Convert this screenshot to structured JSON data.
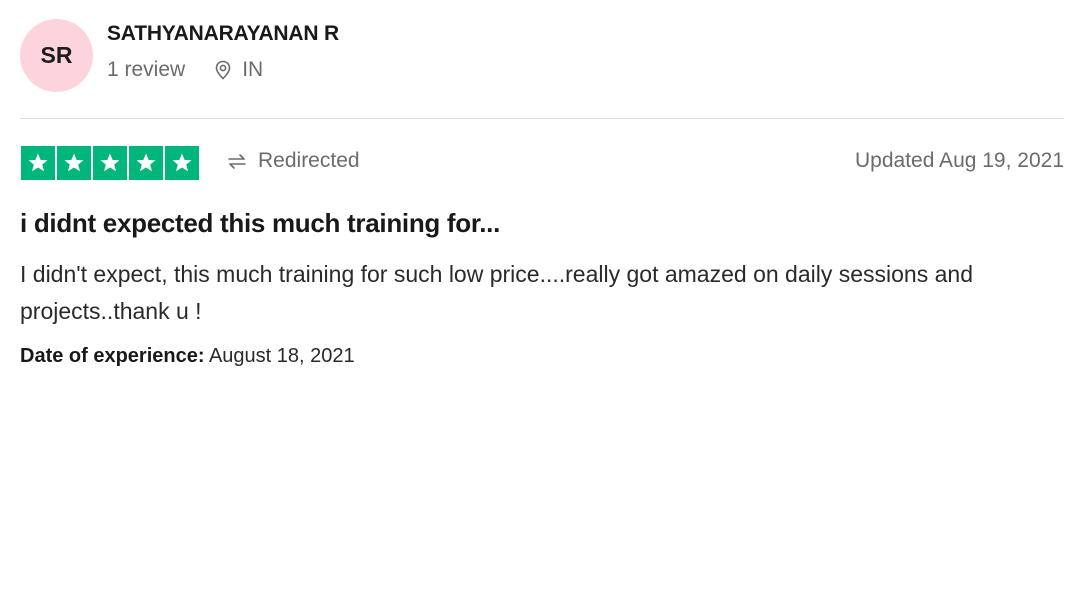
{
  "reviewer": {
    "initials": "SR",
    "avatar_color": "#fdd3dd",
    "name": "SATHYANARAYANAN R",
    "review_count": "1 review",
    "location_icon": "location-pin-icon",
    "country": "IN"
  },
  "rating": {
    "stars": 5,
    "max_stars": 5,
    "star_color": "#00b67a",
    "redirect_icon": "redirect-arrow-icon",
    "redirect_label": "Redirected",
    "updated_text": "Updated Aug 19, 2021"
  },
  "review": {
    "title": "i didnt expected this much training for...",
    "body": "I didn't expect, this much training for such low price....really got amazed on daily sessions and projects..thank u !",
    "experience_label": "Date of experience:",
    "experience_date": "August 18, 2021"
  }
}
